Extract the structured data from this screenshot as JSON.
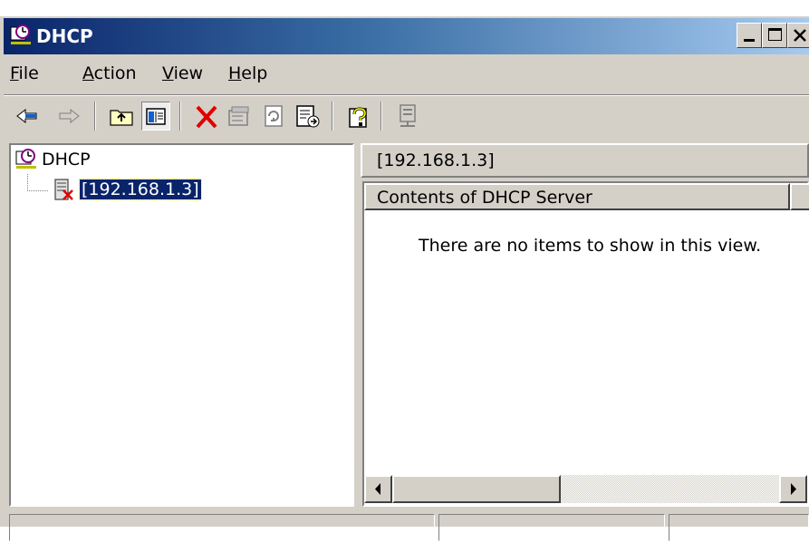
{
  "window": {
    "title": "DHCP",
    "controls": {
      "minimize": "_",
      "maximize": "□",
      "close": "×"
    }
  },
  "menu": {
    "items": [
      {
        "label": "File",
        "accel": "F",
        "rest": "ile"
      },
      {
        "label": "Action",
        "accel": "A",
        "rest": "ction"
      },
      {
        "label": "View",
        "accel": "V",
        "rest": "iew"
      },
      {
        "label": "Help",
        "accel": "H",
        "rest": "elp"
      }
    ]
  },
  "toolbar": {
    "icons": [
      "back-arrow-icon",
      "forward-arrow-icon",
      "up-folder-icon",
      "show-hide-tree-icon",
      "delete-icon",
      "properties-icon",
      "refresh-icon",
      "export-list-icon",
      "help-icon",
      "server-icon"
    ]
  },
  "tree": {
    "root_label": "DHCP",
    "child_label": "[192.168.1.3]"
  },
  "details": {
    "path_label": "[192.168.1.3]",
    "column_header": "Contents of DHCP Server",
    "empty_message": "There are no items to show in this view."
  },
  "colors": {
    "title_start": "#0a246a",
    "title_end": "#a6caf0",
    "face": "#d4d0c8",
    "selection": "#0a246a"
  }
}
